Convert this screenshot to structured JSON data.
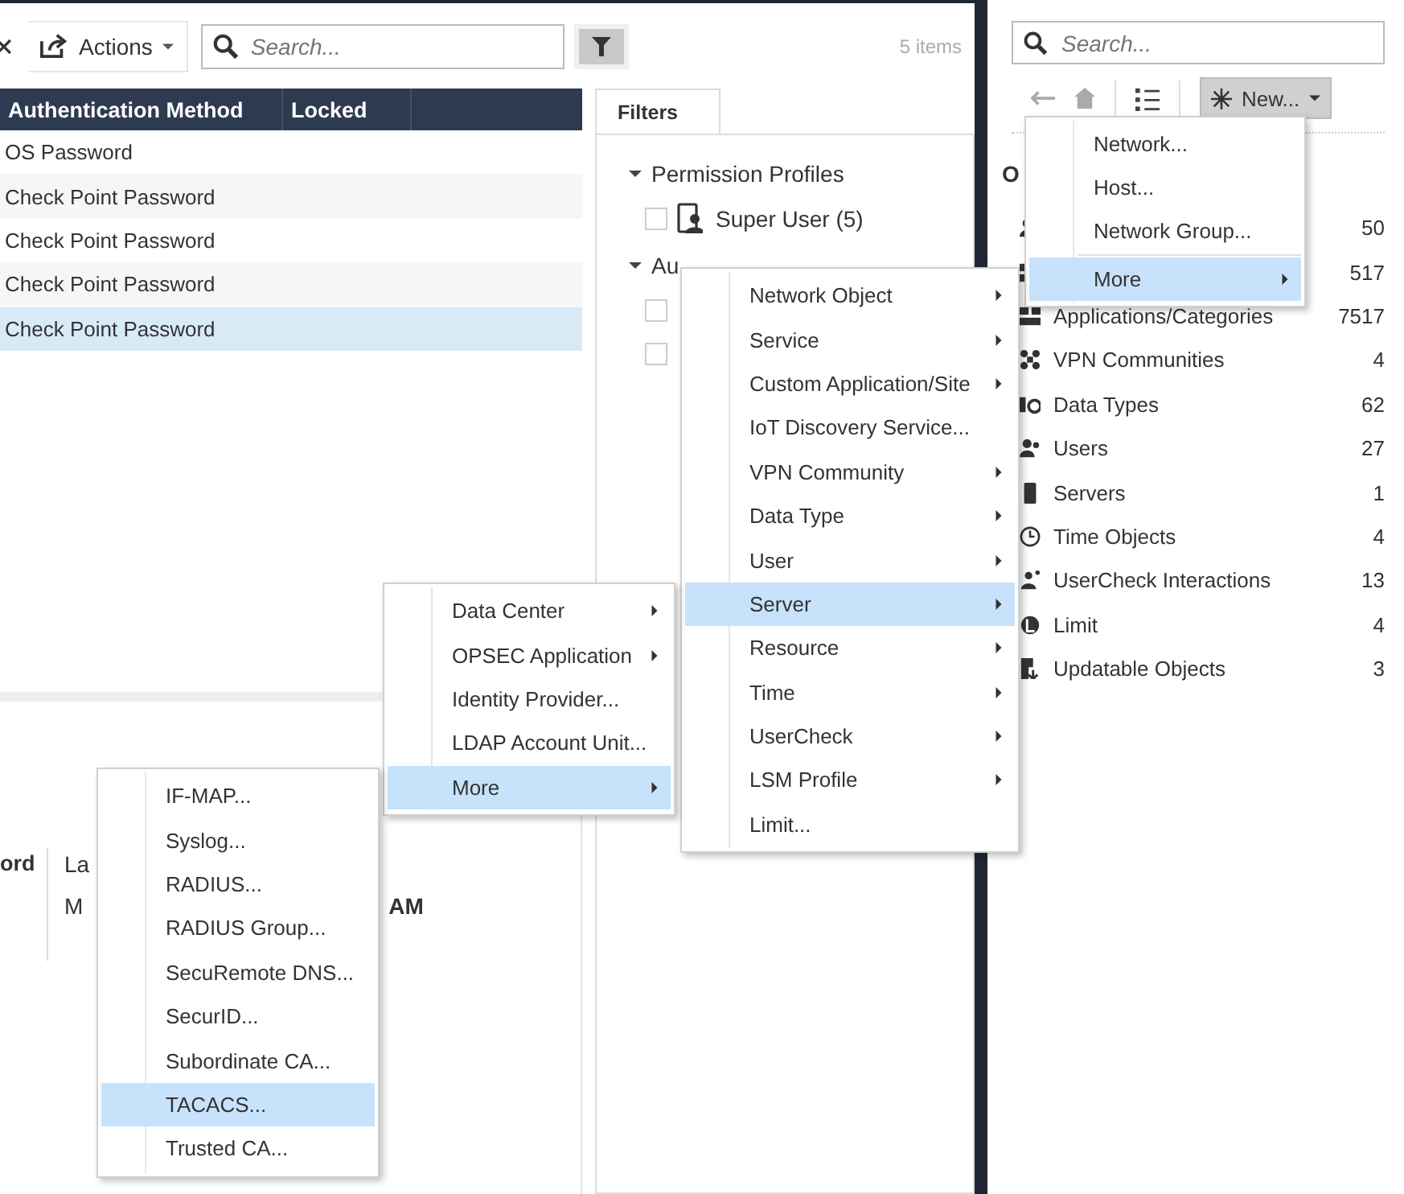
{
  "toolbar": {
    "actions_label": "Actions",
    "search_placeholder": "Search...",
    "item_count": "5 items"
  },
  "table": {
    "columns": [
      "Authentication Method",
      "Locked"
    ],
    "rows": [
      {
        "authentication_method": "OS Password",
        "selected": false
      },
      {
        "authentication_method": "Check Point Password",
        "selected": false
      },
      {
        "authentication_method": "Check Point Password",
        "selected": false
      },
      {
        "authentication_method": "Check Point Password",
        "selected": false
      },
      {
        "authentication_method": "Check Point Password",
        "selected": true
      }
    ]
  },
  "filters": {
    "tab": "Filters",
    "groups": [
      {
        "label": "Permission Profiles",
        "expanded": true,
        "options": [
          {
            "label": "Super User (5)",
            "checked": false
          }
        ]
      },
      {
        "label": "Au",
        "expanded": true,
        "options": [
          {
            "checked": false
          },
          {
            "checked": false
          }
        ]
      }
    ]
  },
  "details": {
    "label": "ord",
    "lines": [
      "La",
      "M"
    ],
    "value": "AM"
  },
  "objects_panel": {
    "search_placeholder": "Search...",
    "new_button": "New...",
    "heading": "O",
    "categories": [
      {
        "count": "50"
      },
      {
        "count": "517"
      },
      {
        "label": "Applications/Categories",
        "count": "7517"
      },
      {
        "label": "VPN Communities",
        "count": "4"
      },
      {
        "label": "Data Types",
        "count": "62"
      },
      {
        "label": "Users",
        "count": "27"
      },
      {
        "label": "Servers",
        "count": "1"
      },
      {
        "label": "Time Objects",
        "count": "4"
      },
      {
        "label": "UserCheck Interactions",
        "count": "13"
      },
      {
        "label": "Limit",
        "count": "4"
      },
      {
        "label": "Updatable Objects",
        "count": "3"
      }
    ]
  },
  "menus": [
    {
      "items": [
        {
          "kind": "command",
          "label": "Network...",
          "selected": false
        },
        {
          "kind": "command",
          "label": "Host...",
          "selected": false
        },
        {
          "kind": "command",
          "label": "Network Group...",
          "selected": false
        },
        {
          "kind": "separator"
        },
        {
          "kind": "submenu",
          "label": "More",
          "selected": true
        }
      ]
    },
    {
      "items": [
        {
          "kind": "submenu",
          "label": "Network Object",
          "selected": false
        },
        {
          "kind": "submenu",
          "label": "Service",
          "selected": false
        },
        {
          "kind": "submenu",
          "label": "Custom Application/Site",
          "selected": false
        },
        {
          "kind": "command",
          "label": "IoT Discovery Service...",
          "selected": false
        },
        {
          "kind": "submenu",
          "label": "VPN Community",
          "selected": false
        },
        {
          "kind": "submenu",
          "label": "Data Type",
          "selected": false
        },
        {
          "kind": "submenu",
          "label": "User",
          "selected": false
        },
        {
          "kind": "submenu",
          "label": "Server",
          "selected": true
        },
        {
          "kind": "submenu",
          "label": "Resource",
          "selected": false
        },
        {
          "kind": "submenu",
          "label": "Time",
          "selected": false
        },
        {
          "kind": "submenu",
          "label": "UserCheck",
          "selected": false
        },
        {
          "kind": "submenu",
          "label": "LSM Profile",
          "selected": false
        },
        {
          "kind": "command",
          "label": "Limit...",
          "selected": false
        }
      ]
    },
    {
      "items": [
        {
          "kind": "submenu",
          "label": "Data Center",
          "selected": false
        },
        {
          "kind": "submenu",
          "label": "OPSEC Application",
          "selected": false
        },
        {
          "kind": "command",
          "label": "Identity Provider...",
          "selected": false
        },
        {
          "kind": "command",
          "label": "LDAP Account Unit...",
          "selected": false
        },
        {
          "kind": "submenu",
          "label": "More",
          "selected": true
        }
      ]
    },
    {
      "items": [
        {
          "kind": "command",
          "label": "IF-MAP...",
          "selected": false
        },
        {
          "kind": "command",
          "label": "Syslog...",
          "selected": false
        },
        {
          "kind": "command",
          "label": "RADIUS...",
          "selected": false
        },
        {
          "kind": "command",
          "label": "RADIUS Group...",
          "selected": false
        },
        {
          "kind": "command",
          "label": "SecuRemote DNS...",
          "selected": false
        },
        {
          "kind": "command",
          "label": "SecurID...",
          "selected": false
        },
        {
          "kind": "command",
          "label": "Subordinate CA...",
          "selected": false
        },
        {
          "kind": "command",
          "label": "TACACS...",
          "selected": true
        },
        {
          "kind": "command",
          "label": "Trusted CA...",
          "selected": false
        }
      ]
    }
  ]
}
